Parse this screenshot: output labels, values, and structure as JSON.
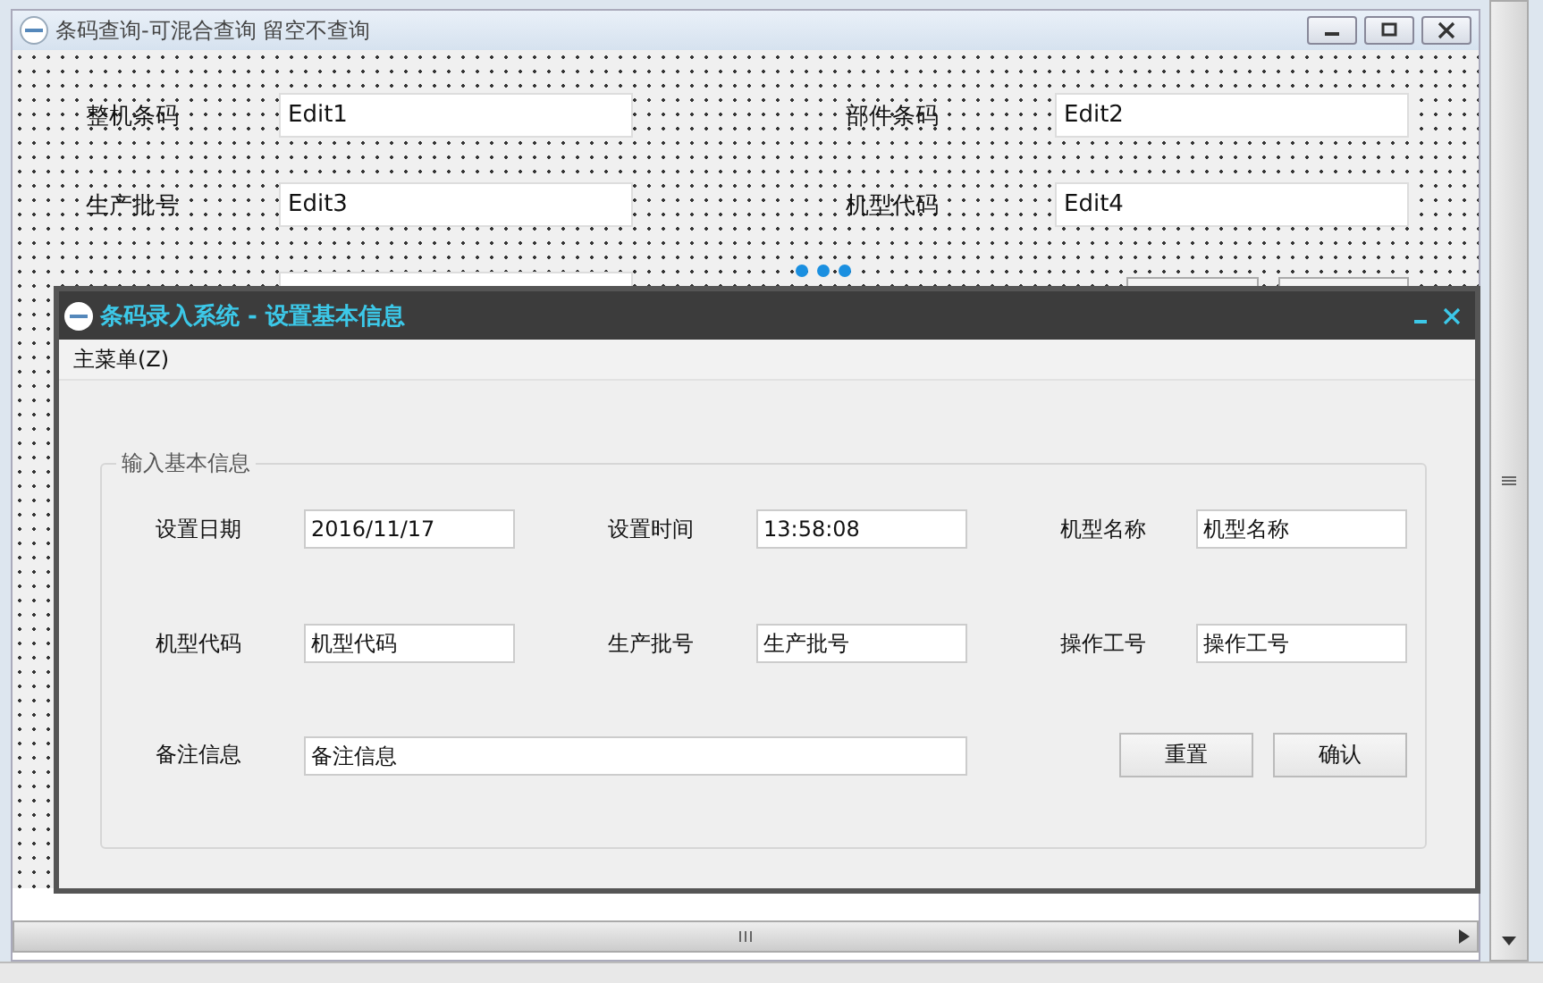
{
  "designer_window": {
    "title": "条码查询-可混合查询 留空不查询",
    "fields": [
      {
        "label": "整机条码",
        "value": "Edit1"
      },
      {
        "label": "部件条码",
        "value": "Edit2"
      },
      {
        "label": "生产批号",
        "value": "Edit3"
      },
      {
        "label": "机型代码",
        "value": "Edit4"
      }
    ]
  },
  "dialog": {
    "title": "条码录入系统 - 设置基本信息",
    "menu": [
      "主菜单(Z)"
    ],
    "group": {
      "title": "输入基本信息",
      "fields": [
        {
          "label": "设置日期",
          "value": "2016/11/17"
        },
        {
          "label": "设置时间",
          "value": "13:58:08"
        },
        {
          "label": "机型名称",
          "value": "机型名称"
        },
        {
          "label": "机型代码",
          "value": "机型代码"
        },
        {
          "label": "生产批号",
          "value": "生产批号"
        },
        {
          "label": "操作工号",
          "value": "操作工号"
        }
      ],
      "remark": {
        "label": "备注信息",
        "value": "备注信息"
      }
    },
    "buttons": [
      "重置",
      "确认"
    ]
  }
}
